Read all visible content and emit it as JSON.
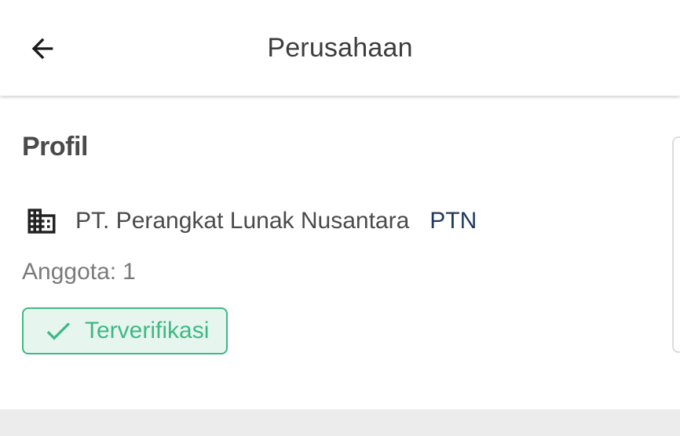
{
  "app_bar": {
    "title": "Perusahaan",
    "back_icon": "arrow-left-icon"
  },
  "profile": {
    "section_title": "Profil",
    "company_icon": "building-icon",
    "company_name": "PT. Perangkat Lunak Nusantara",
    "company_code": "PTN",
    "members_label": "Anggota:",
    "members_count": "1",
    "verified_icon": "check-icon",
    "verified_label": "Terverifikasi"
  },
  "colors": {
    "code_text": "#1f3a5f",
    "verified_green": "#3fb884",
    "verified_bg": "#e6f6ef"
  }
}
